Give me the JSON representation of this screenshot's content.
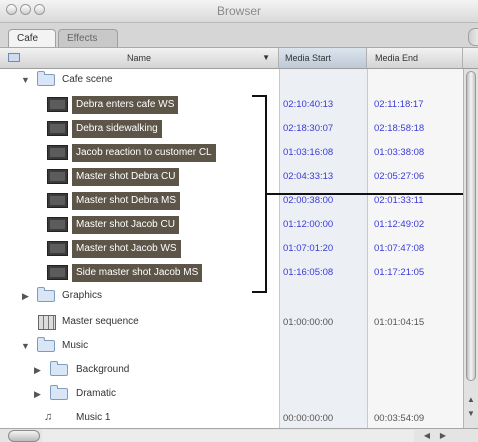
{
  "window": {
    "title": "Browser"
  },
  "tabs": [
    {
      "label": "Cafe"
    },
    {
      "label": "Effects"
    }
  ],
  "columns": {
    "name": "Name",
    "media_start": "Media Start",
    "media_end": "Media End"
  },
  "rows": [
    {
      "name": "Cafe scene",
      "media_start": "",
      "media_end": ""
    },
    {
      "name": "Debra enters cafe WS",
      "media_start": "02:10:40:13",
      "media_end": "02:11:18:17"
    },
    {
      "name": "Debra sidewalking",
      "media_start": "02:18:30:07",
      "media_end": "02:18:58:18"
    },
    {
      "name": "Jacob reaction to customer CL",
      "media_start": "01:03:16:08",
      "media_end": "01:03:38:08"
    },
    {
      "name": "Master shot Debra CU",
      "media_start": "02:04:33:13",
      "media_end": "02:05:27:06"
    },
    {
      "name": "Master shot Debra MS",
      "media_start": "02:00:38:00",
      "media_end": "02:01:33:11"
    },
    {
      "name": "Master shot Jacob CU",
      "media_start": "01:12:00:00",
      "media_end": "01:12:49:02"
    },
    {
      "name": "Master shot Jacob WS",
      "media_start": "01:07:01:20",
      "media_end": "01:07:47:08"
    },
    {
      "name": "Side master shot Jacob MS",
      "media_start": "01:16:05:08",
      "media_end": "01:17:21:05"
    },
    {
      "name": "Graphics",
      "media_start": "",
      "media_end": ""
    },
    {
      "name": "Master sequence",
      "media_start": "01:00:00:00",
      "media_end": "01:01:04:15"
    },
    {
      "name": "Music",
      "media_start": "",
      "media_end": ""
    },
    {
      "name": "Background",
      "media_start": "",
      "media_end": ""
    },
    {
      "name": "Dramatic",
      "media_start": "",
      "media_end": ""
    },
    {
      "name": "Music 1",
      "media_start": "00:00:00:00",
      "media_end": "00:03:54:09"
    }
  ]
}
